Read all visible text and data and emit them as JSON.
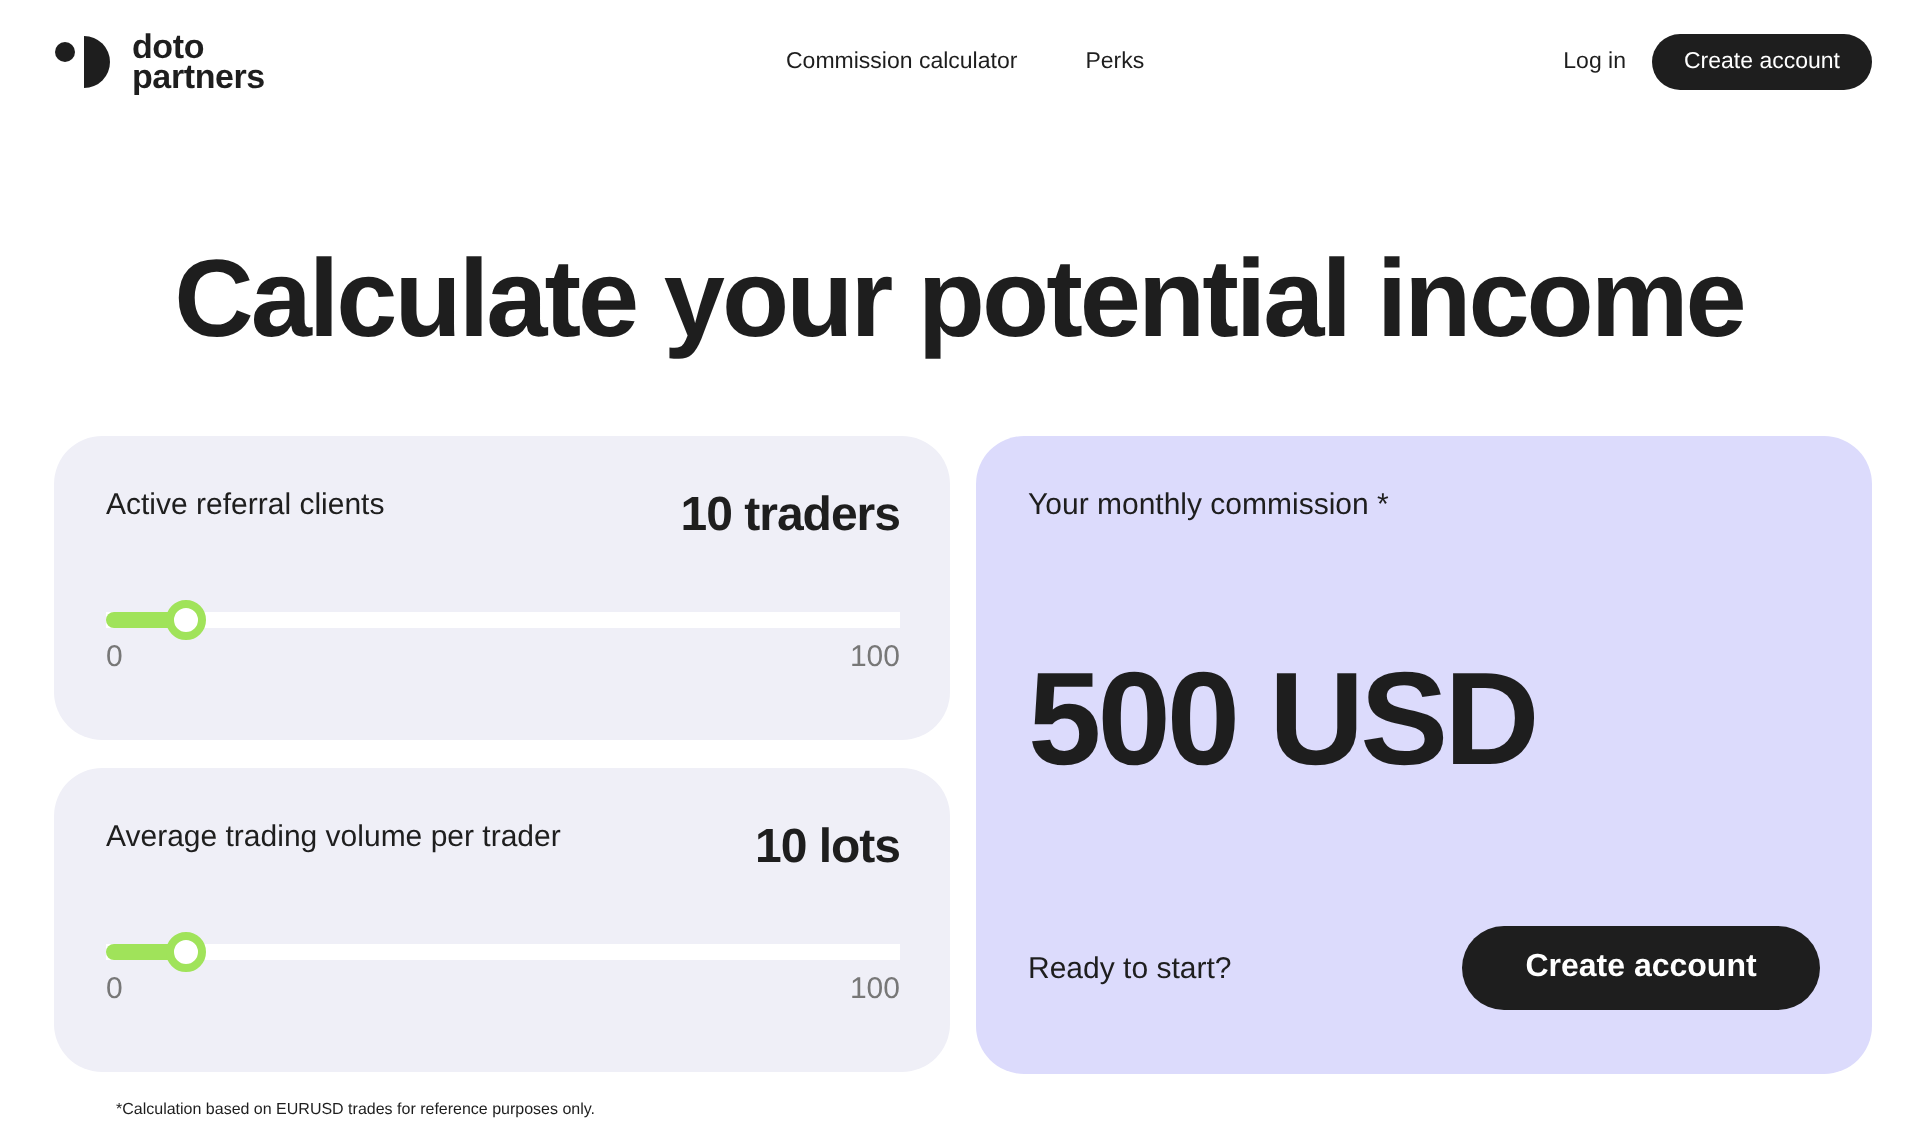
{
  "header": {
    "logo": "doto\npartners",
    "nav": [
      "Commission calculator",
      "Perks"
    ],
    "login": "Log in",
    "cta": "Create account"
  },
  "title": "Calculate your potential income",
  "sliders": [
    {
      "label": "Active referral clients",
      "value": "10 traders",
      "level": 0.1,
      "min": "0",
      "max": "100"
    },
    {
      "label": "Average trading volume per trader",
      "value": "10 lots",
      "level": 0.1,
      "min": "0",
      "max": "100"
    }
  ],
  "result": {
    "label": "Your monthly commission *",
    "amount": "500 USD",
    "prompt": "Ready to start?",
    "button": "Create account"
  },
  "footnote": "*Calculation based on EURUSD trades for reference purposes only."
}
